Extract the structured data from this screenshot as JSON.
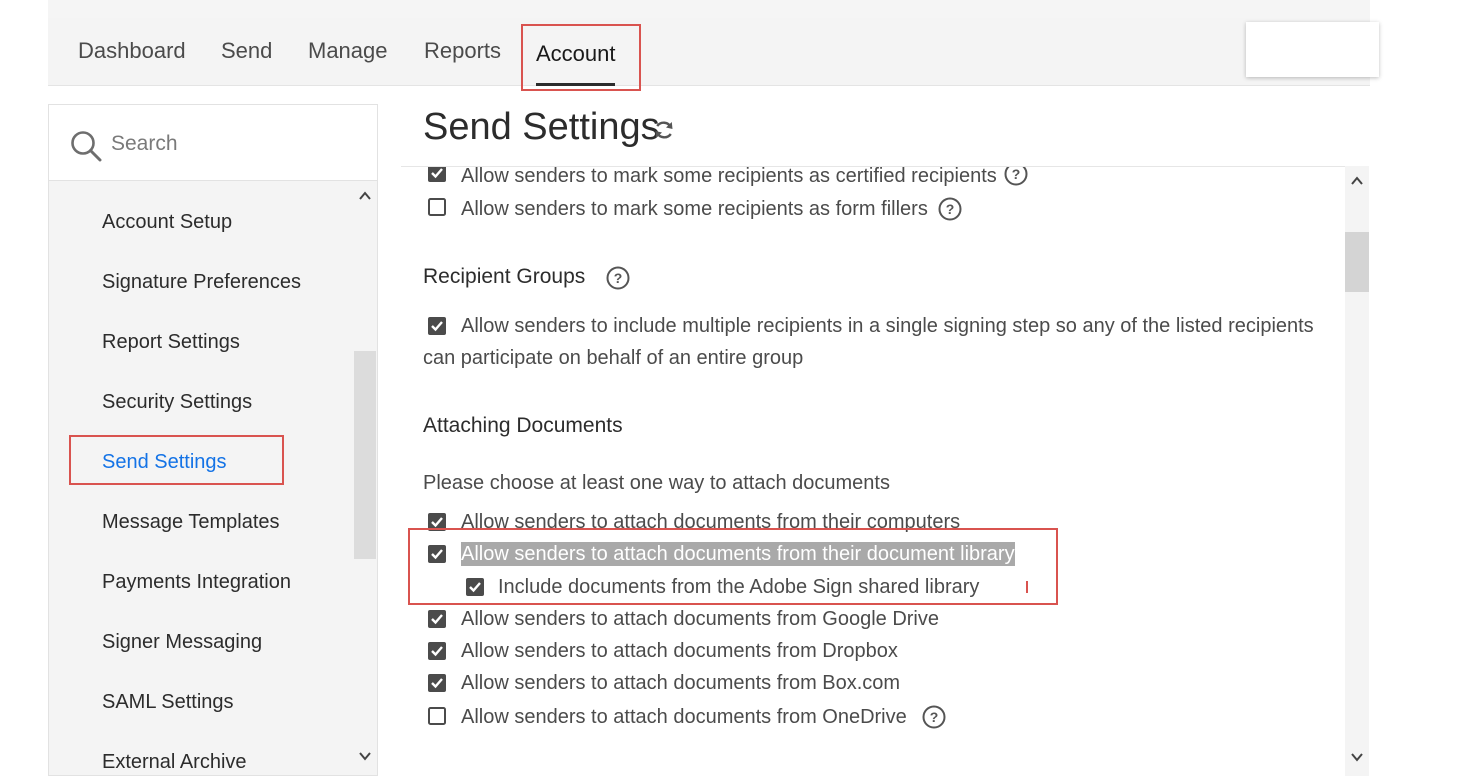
{
  "nav": {
    "tabs": [
      {
        "label": "Dashboard"
      },
      {
        "label": "Send"
      },
      {
        "label": "Manage"
      },
      {
        "label": "Reports"
      },
      {
        "label": "Account"
      }
    ],
    "active_tab": "Account"
  },
  "sidebar": {
    "search_placeholder": "Search",
    "items": [
      {
        "label": "Account Setup"
      },
      {
        "label": "Signature Preferences"
      },
      {
        "label": "Report Settings"
      },
      {
        "label": "Security Settings"
      },
      {
        "label": "Send Settings"
      },
      {
        "label": "Message Templates"
      },
      {
        "label": "Payments Integration"
      },
      {
        "label": "Signer Messaging"
      },
      {
        "label": "SAML Settings"
      },
      {
        "label": "External Archive"
      }
    ],
    "active_item": "Send Settings"
  },
  "main": {
    "title": "Send Settings",
    "options_top": [
      {
        "label": "Allow senders to mark some recipients as certified recipients",
        "checked": true
      },
      {
        "label": "Allow senders to mark some recipients as form fillers",
        "checked": false
      }
    ],
    "recipient_groups": {
      "heading": "Recipient Groups",
      "option_line1": "Allow senders to include multiple recipients in a single signing step so any of the listed recipients",
      "option_line2": "can participate on behalf of an entire group",
      "checked": true
    },
    "attaching": {
      "heading": "Attaching Documents",
      "instruction": "Please choose at least one way to attach documents",
      "options": [
        {
          "label": "Allow senders to attach documents from their computers",
          "checked": true
        },
        {
          "label": "Allow senders to attach documents from their document library",
          "checked": true
        },
        {
          "label": "Include documents from the Adobe Sign shared library",
          "checked": true
        },
        {
          "label": "Allow senders to attach documents from Google Drive",
          "checked": true
        },
        {
          "label": "Allow senders to attach documents from Dropbox",
          "checked": true
        },
        {
          "label": "Allow senders to attach documents from Box.com",
          "checked": true
        },
        {
          "label": "Allow senders to attach documents from OneDrive",
          "checked": false
        }
      ]
    }
  },
  "colors": {
    "accent": "#1473e6",
    "callout": "#d9534f",
    "checkbox": "#4b4b4b",
    "highlight": "#a9a9a9"
  }
}
